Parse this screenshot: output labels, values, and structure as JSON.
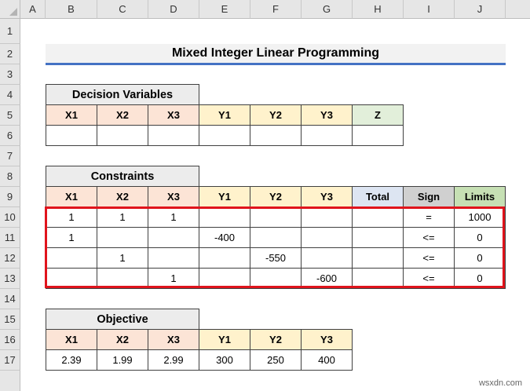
{
  "columns": [
    "A",
    "B",
    "C",
    "D",
    "E",
    "F",
    "G",
    "H",
    "I",
    "J"
  ],
  "rows": [
    "1",
    "2",
    "3",
    "4",
    "5",
    "6",
    "7",
    "8",
    "9",
    "10",
    "11",
    "12",
    "13",
    "14",
    "15",
    "16",
    "17"
  ],
  "title": "Mixed Integer Linear Programming",
  "decision": {
    "title": "Decision Variables",
    "headers": [
      "X1",
      "X2",
      "X3",
      "Y1",
      "Y2",
      "Y3",
      "Z"
    ],
    "values": [
      "",
      "",
      "",
      "",
      "",
      "",
      ""
    ]
  },
  "constraints": {
    "title": "Constraints",
    "headers": [
      "X1",
      "X2",
      "X3",
      "Y1",
      "Y2",
      "Y3",
      "Total",
      "Sign",
      "Limits"
    ],
    "rows": [
      [
        "1",
        "1",
        "1",
        "",
        "",
        "",
        "",
        "=",
        "1000"
      ],
      [
        "1",
        "",
        "",
        "-400",
        "",
        "",
        "",
        "<=",
        "0"
      ],
      [
        "",
        "1",
        "",
        "",
        "-550",
        "",
        "",
        "<=",
        "0"
      ],
      [
        "",
        "",
        "1",
        "",
        "",
        "-600",
        "",
        "<=",
        "0"
      ]
    ]
  },
  "objective": {
    "title": "Objective",
    "headers": [
      "X1",
      "X2",
      "X3",
      "Y1",
      "Y2",
      "Y3"
    ],
    "values": [
      "2.39",
      "1.99",
      "2.99",
      "300",
      "250",
      "400"
    ]
  },
  "watermark": "wsxdn.com",
  "colors": {
    "x_header": "#fce4d6",
    "y_header": "#fff2cc",
    "z_header": "#e2efda",
    "total_header": "#dde5f2",
    "sign_header": "#d0d0d0",
    "limits_header": "#c6e0b4",
    "highlight_border": "#e0141c",
    "title_underline": "#4472c4"
  }
}
